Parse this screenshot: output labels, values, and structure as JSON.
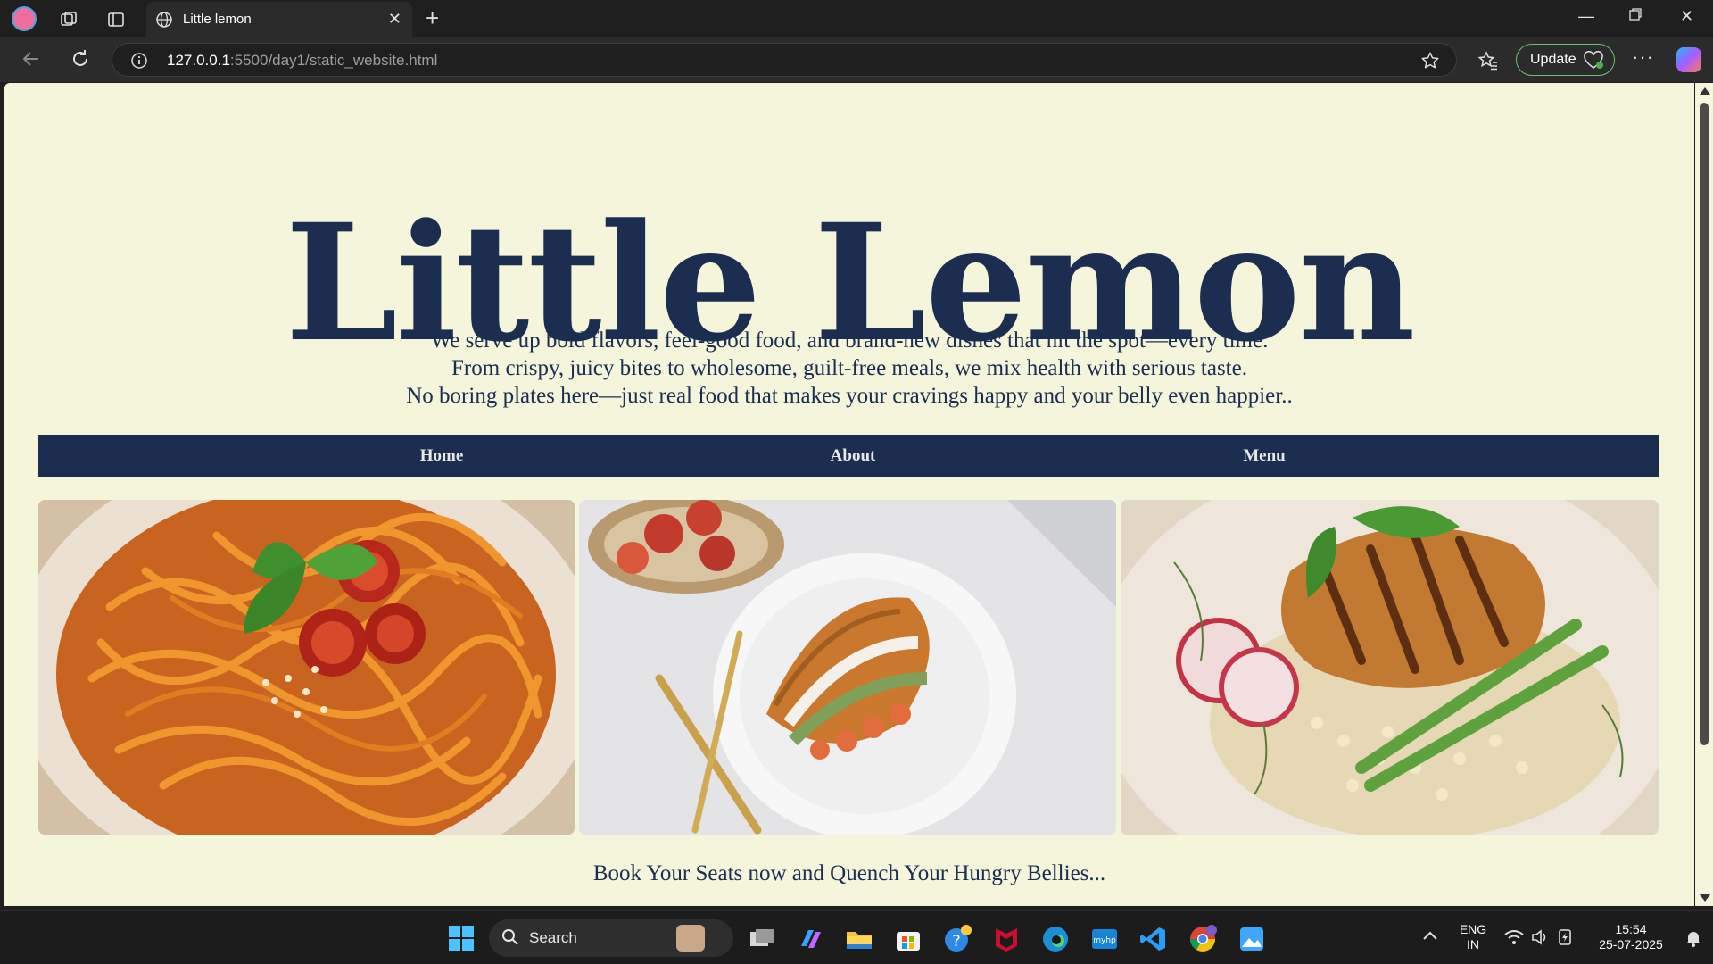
{
  "browser": {
    "tab_title": "Little lemon",
    "url_host": "127.0.0.1",
    "url_rest": ":5500/day1/static_website.html",
    "update_label": "Update"
  },
  "page": {
    "title": "Little Lemon",
    "tagline_lines": [
      "We serve up bold flavors, feel-good food, and brand-new dishes that hit the spot—every time.",
      "From crispy, juicy bites to wholesome, guilt-free meals, we mix health with serious taste.",
      "No boring plates here—just real food that makes your cravings happy and your belly even happier.."
    ],
    "nav": [
      "Home",
      "About",
      "Menu"
    ],
    "images": [
      "pasta-dish",
      "croissant-sandwich-dish",
      "grilled-chicken-risotto-dish"
    ],
    "footer": "Book Your Seats now and Quench Your Hungry Bellies...",
    "colors": {
      "background": "#f5f5dc",
      "primary": "#1b2e4f"
    }
  },
  "taskbar": {
    "search_label": "Search",
    "lang_top": "ENG",
    "lang_bottom": "IN",
    "time": "15:54",
    "date": "25-07-2025"
  }
}
